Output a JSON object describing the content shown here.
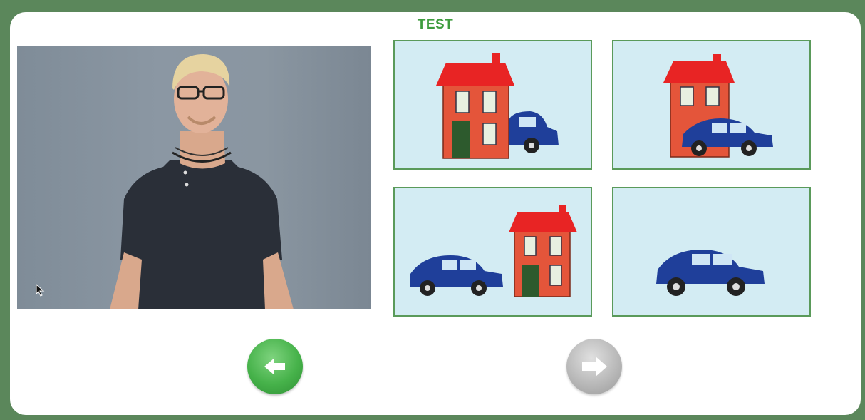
{
  "header": {
    "title": "TEST"
  },
  "video": {
    "subject": "person-signing"
  },
  "choices": [
    {
      "id": "house-car-right-behind"
    },
    {
      "id": "house-car-front"
    },
    {
      "id": "car-left-house-right"
    },
    {
      "id": "car-only"
    }
  ],
  "navigation": {
    "back_icon": "arrow-left-icon",
    "next_icon": "arrow-right-icon",
    "back_color": "#46b24a",
    "next_color": "#b9b9b9"
  },
  "colors": {
    "frame": "#5b875b",
    "accent": "#3e9c3e",
    "picture_bg": "#d3ecf3",
    "picture_border": "#5a9a5a"
  }
}
